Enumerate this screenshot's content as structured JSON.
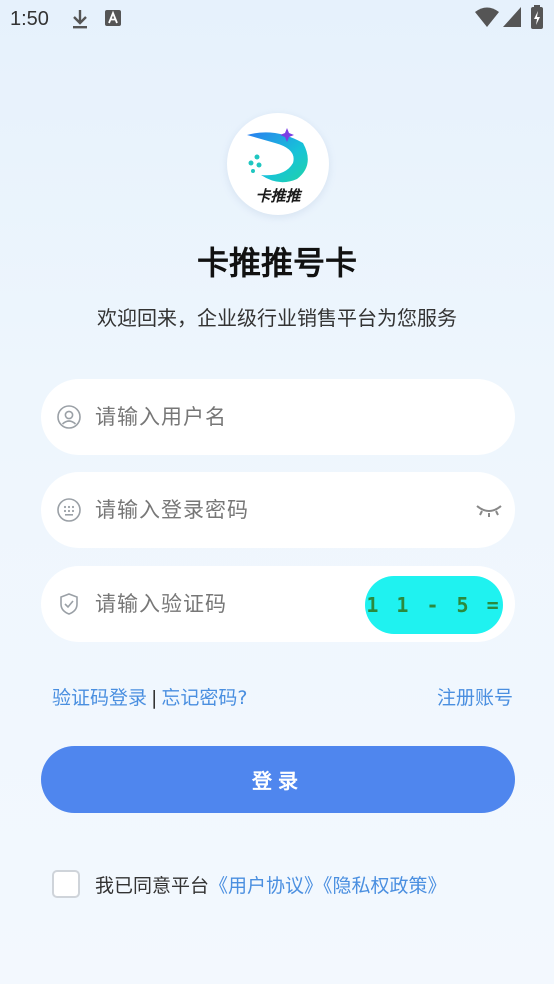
{
  "status_bar": {
    "time": "1:50"
  },
  "brand": {
    "logo_text": "卡推推",
    "title": "卡推推号卡",
    "subtitle": "欢迎回来，企业级行业销售平台为您服务"
  },
  "form": {
    "username_placeholder": "请输入用户名",
    "password_placeholder": "请输入登录密码",
    "captcha_placeholder": "请输入验证码",
    "captcha_text": "1 1 - 5 = ?"
  },
  "links": {
    "sms_login": "验证码登录",
    "separator": "|",
    "forgot_password": "忘记密码?",
    "register": "注册账号"
  },
  "login_button": "登录",
  "agreement": {
    "prefix": "我已同意平台",
    "user_agreement": "《用户协议》",
    "privacy_policy": "《隐私权政策》",
    "checked": false
  },
  "colors": {
    "accent": "#4f86ee",
    "link": "#4a8fe0",
    "captcha_bg": "#1ff2f0"
  },
  "icons": [
    "download-icon",
    "text-icon",
    "wifi-icon",
    "signal-icon",
    "battery-icon",
    "user-icon",
    "keypad-icon",
    "shield-icon",
    "eye-closed-icon"
  ]
}
